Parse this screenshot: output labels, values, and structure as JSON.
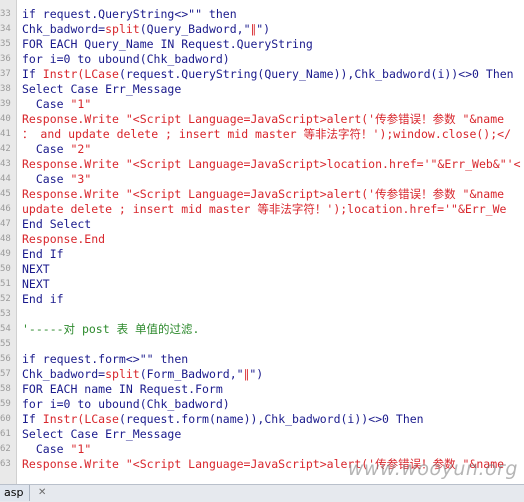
{
  "editor": {
    "lines": [
      {
        "no": "33",
        "segments": [
          {
            "c": "kw",
            "t": "if request.QueryString<>\"\" then"
          }
        ]
      },
      {
        "no": "34",
        "segments": [
          {
            "c": "plain",
            "t": "Chk_badword="
          },
          {
            "c": "bi",
            "t": "split"
          },
          {
            "c": "plain",
            "t": "(Query_Badword,\""
          },
          {
            "c": "str",
            "t": "∥"
          },
          {
            "c": "plain",
            "t": "\")"
          }
        ]
      },
      {
        "no": "35",
        "segments": [
          {
            "c": "kw",
            "t": "FOR EACH Query_Name IN Request.QueryString"
          }
        ]
      },
      {
        "no": "36",
        "segments": [
          {
            "c": "kw",
            "t": "for i=0 to ubound(Chk_badword)"
          }
        ]
      },
      {
        "no": "37",
        "segments": [
          {
            "c": "kw",
            "t": "If "
          },
          {
            "c": "bi",
            "t": "Instr(LCase"
          },
          {
            "c": "plain",
            "t": "(request.QueryString(Query_Name)),Chk_badword(i))<>0 Then"
          }
        ]
      },
      {
        "no": "38",
        "segments": [
          {
            "c": "kw",
            "t": "Select Case Err_Message"
          }
        ]
      },
      {
        "no": "39",
        "segments": [
          {
            "c": "kw",
            "t": "  Case "
          },
          {
            "c": "str",
            "t": "\"1\""
          }
        ]
      },
      {
        "no": "40",
        "segments": [
          {
            "c": "bi",
            "t": "Response.Write "
          },
          {
            "c": "str",
            "t": "\"<Script Language=JavaScript>alert('传参错误！参数 \"&name"
          }
        ]
      },
      {
        "no": "41",
        "segments": [
          {
            "c": "str",
            "t": "： and update delete ; insert mid master 等非法字符！');window.close();</"
          }
        ]
      },
      {
        "no": "42",
        "segments": [
          {
            "c": "kw",
            "t": "  Case "
          },
          {
            "c": "str",
            "t": "\"2\""
          }
        ]
      },
      {
        "no": "43",
        "segments": [
          {
            "c": "bi",
            "t": "Response.Write "
          },
          {
            "c": "str",
            "t": "\"<Script Language=JavaScript>location.href='\"&Err_Web&\"'<"
          }
        ]
      },
      {
        "no": "44",
        "segments": [
          {
            "c": "kw",
            "t": "  Case "
          },
          {
            "c": "str",
            "t": "\"3\""
          }
        ]
      },
      {
        "no": "45",
        "segments": [
          {
            "c": "bi",
            "t": "Response.Write "
          },
          {
            "c": "str",
            "t": "\"<Script Language=JavaScript>alert('传参错误！参数 \"&name"
          }
        ]
      },
      {
        "no": "46",
        "segments": [
          {
            "c": "str",
            "t": "update delete ; insert mid master 等非法字符！');location.href='\"&Err_We"
          }
        ]
      },
      {
        "no": "47",
        "segments": [
          {
            "c": "kw",
            "t": "End Select"
          }
        ]
      },
      {
        "no": "48",
        "segments": [
          {
            "c": "bi",
            "t": "Response.End"
          }
        ]
      },
      {
        "no": "49",
        "segments": [
          {
            "c": "kw",
            "t": "End If"
          }
        ]
      },
      {
        "no": "50",
        "segments": [
          {
            "c": "kw",
            "t": "NEXT"
          }
        ]
      },
      {
        "no": "51",
        "segments": [
          {
            "c": "kw",
            "t": "NEXT"
          }
        ]
      },
      {
        "no": "52",
        "segments": [
          {
            "c": "kw",
            "t": "End if"
          }
        ]
      },
      {
        "no": "53",
        "segments": []
      },
      {
        "no": "54",
        "segments": [
          {
            "c": "cm",
            "t": "'-----对 post 表 单值的过滤."
          }
        ]
      },
      {
        "no": "55",
        "segments": []
      },
      {
        "no": "56",
        "segments": [
          {
            "c": "kw",
            "t": "if request.form<>\"\" then"
          }
        ]
      },
      {
        "no": "57",
        "segments": [
          {
            "c": "plain",
            "t": "Chk_badword="
          },
          {
            "c": "bi",
            "t": "split"
          },
          {
            "c": "plain",
            "t": "(Form_Badword,\""
          },
          {
            "c": "str",
            "t": "∥"
          },
          {
            "c": "plain",
            "t": "\")"
          }
        ]
      },
      {
        "no": "58",
        "segments": [
          {
            "c": "kw",
            "t": "FOR EACH name IN Request.Form"
          }
        ]
      },
      {
        "no": "59",
        "segments": [
          {
            "c": "kw",
            "t": "for i=0 to ubound(Chk_badword)"
          }
        ]
      },
      {
        "no": "60",
        "segments": [
          {
            "c": "kw",
            "t": "If "
          },
          {
            "c": "bi",
            "t": "Instr(LCase"
          },
          {
            "c": "plain",
            "t": "(request.form(name)),Chk_badword(i))<>0 Then"
          }
        ]
      },
      {
        "no": "61",
        "segments": [
          {
            "c": "kw",
            "t": "Select Case Err_Message"
          }
        ]
      },
      {
        "no": "62",
        "segments": [
          {
            "c": "kw",
            "t": "  Case "
          },
          {
            "c": "str",
            "t": "\"1\""
          }
        ]
      },
      {
        "no": "63",
        "segments": [
          {
            "c": "bi",
            "t": "Response.Write "
          },
          {
            "c": "str",
            "t": "\"<Script Language=JavaScript>alert('传参错误！参数 \"&name"
          }
        ]
      }
    ]
  },
  "statusbar": {
    "tab_label": "asp",
    "close_glyph": "✕"
  },
  "watermark": "www.wooyun.org"
}
